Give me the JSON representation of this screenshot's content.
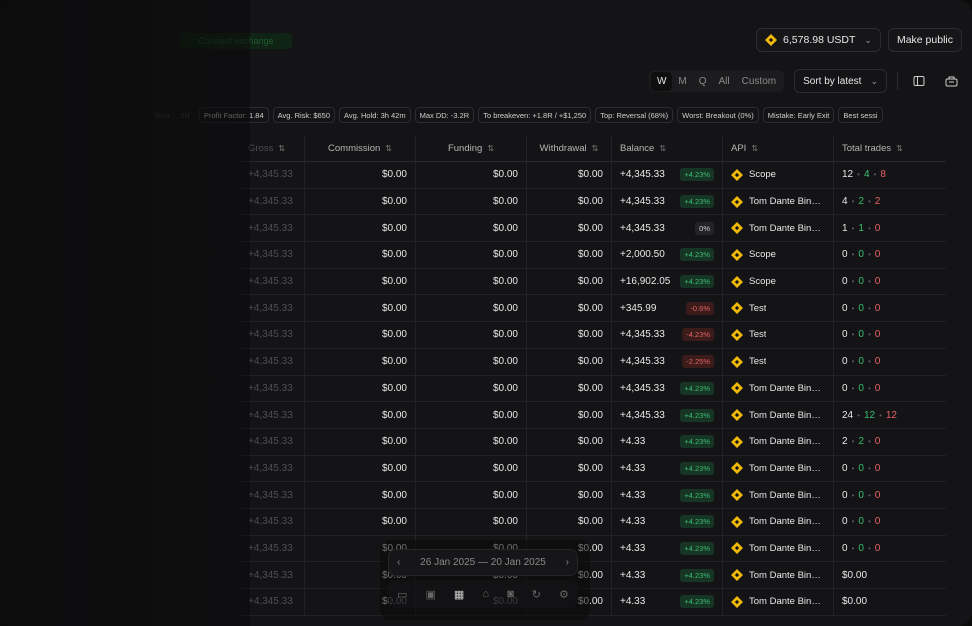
{
  "balance_button": {
    "label": "6,578.98 USDT"
  },
  "make_public": "Make public",
  "ghost_label": "Connect exchange",
  "periods": [
    "W",
    "M",
    "Q",
    "All",
    "Custom"
  ],
  "active_period": "W",
  "sort": "Sort by latest",
  "chips": [
    {
      "label": "Best ... 2R",
      "dim": true
    },
    {
      "label": "Profit Factor: 1.84",
      "dim": false
    },
    {
      "label": "Avg. Risk: $650",
      "dim": false
    },
    {
      "label": "Avg. Hold: 3h 42m",
      "dim": false
    },
    {
      "label": "Max DD: -3.2R",
      "dim": false
    },
    {
      "label": "To breakeven: +1.8R / +$1,250",
      "dim": false
    },
    {
      "label": "Top: Reversal (68%)",
      "dim": false
    },
    {
      "label": "Worst: Breakout (0%)",
      "dim": false
    },
    {
      "label": "Mistake: Early Exit",
      "dim": false
    },
    {
      "label": "Best sessi",
      "dim": false
    }
  ],
  "columns": {
    "gross": "Gross",
    "commission": "Commission",
    "funding": "Funding",
    "withdrawal": "Withdrawal",
    "balance": "Balance",
    "api": "API",
    "total": "Total trades"
  },
  "rows": [
    {
      "gross": "+4,345.33",
      "commission": "$0.00",
      "funding": "$0.00",
      "withdrawal": "$0.00",
      "balance": "+4,345.33",
      "badge": "+4.23%",
      "badge_type": "pos",
      "api": "Scope",
      "total": [
        "12",
        "4",
        "8"
      ]
    },
    {
      "gross": "+4,345.33",
      "commission": "$0.00",
      "funding": "$0.00",
      "withdrawal": "$0.00",
      "balance": "+4,345.33",
      "badge": "+4.23%",
      "badge_type": "pos",
      "api": "Tom Dante Binan...",
      "total": [
        "4",
        "2",
        "2"
      ]
    },
    {
      "gross": "+4,345.33",
      "commission": "$0.00",
      "funding": "$0.00",
      "withdrawal": "$0.00",
      "balance": "+4,345.33",
      "badge": "0%",
      "badge_type": "zero",
      "api": "Tom Dante Binan...",
      "total": [
        "1",
        "1",
        "0"
      ]
    },
    {
      "gross": "+4,345.33",
      "commission": "$0.00",
      "funding": "$0.00",
      "withdrawal": "$0.00",
      "balance": "+2,000.50",
      "badge": "+4.23%",
      "badge_type": "pos",
      "api": "Scope",
      "total": [
        "0",
        "0",
        "0"
      ]
    },
    {
      "gross": "+4,345.33",
      "commission": "$0.00",
      "funding": "$0.00",
      "withdrawal": "$0.00",
      "balance": "+16,902.05",
      "badge": "+4.23%",
      "badge_type": "pos",
      "api": "Scope",
      "total": [
        "0",
        "0",
        "0"
      ]
    },
    {
      "gross": "+4,345.33",
      "commission": "$0.00",
      "funding": "$0.00",
      "withdrawal": "$0.00",
      "balance": "+345.99",
      "badge": "-0.6%",
      "badge_type": "neg",
      "api": "Test",
      "total": [
        "0",
        "0",
        "0"
      ]
    },
    {
      "gross": "+4,345.33",
      "commission": "$0.00",
      "funding": "$0.00",
      "withdrawal": "$0.00",
      "balance": "+4,345.33",
      "badge": "-4.23%",
      "badge_type": "neg",
      "api": "Test",
      "total": [
        "0",
        "0",
        "0"
      ]
    },
    {
      "gross": "+4,345.33",
      "commission": "$0.00",
      "funding": "$0.00",
      "withdrawal": "$0.00",
      "balance": "+4,345.33",
      "badge": "-2.25%",
      "badge_type": "neg",
      "api": "Test",
      "total": [
        "0",
        "0",
        "0"
      ]
    },
    {
      "gross": "+4,345.33",
      "commission": "$0.00",
      "funding": "$0.00",
      "withdrawal": "$0.00",
      "balance": "+4,345.33",
      "badge": "+4.23%",
      "badge_type": "pos",
      "api": "Tom Dante Binan...",
      "total": [
        "0",
        "0",
        "0"
      ]
    },
    {
      "gross": "+4,345.33",
      "commission": "$0.00",
      "funding": "$0.00",
      "withdrawal": "$0.00",
      "balance": "+4,345.33",
      "badge": "+4.23%",
      "badge_type": "pos",
      "api": "Tom Dante Binan...",
      "total": [
        "24",
        "12",
        "12"
      ]
    },
    {
      "gross": "+4,345.33",
      "commission": "$0.00",
      "funding": "$0.00",
      "withdrawal": "$0.00",
      "balance": "+4.33",
      "badge": "+4.23%",
      "badge_type": "pos",
      "api": "Tom Dante Binan...",
      "total": [
        "2",
        "2",
        "0"
      ]
    },
    {
      "gross": "+4,345.33",
      "commission": "$0.00",
      "funding": "$0.00",
      "withdrawal": "$0.00",
      "balance": "+4.33",
      "badge": "+4.23%",
      "badge_type": "pos",
      "api": "Tom Dante Binan...",
      "total": [
        "0",
        "0",
        "0"
      ]
    },
    {
      "gross": "+4,345.33",
      "commission": "$0.00",
      "funding": "$0.00",
      "withdrawal": "$0.00",
      "balance": "+4.33",
      "badge": "+4.23%",
      "badge_type": "pos",
      "api": "Tom Dante Binan...",
      "total": [
        "0",
        "0",
        "0"
      ]
    },
    {
      "gross": "+4,345.33",
      "commission": "$0.00",
      "funding": "$0.00",
      "withdrawal": "$0.00",
      "balance": "+4.33",
      "badge": "+4.23%",
      "badge_type": "pos",
      "api": "Tom Dante Binan...",
      "total": [
        "0",
        "0",
        "0"
      ]
    },
    {
      "gross": "+4,345.33",
      "commission": "$0.00",
      "funding": "$0.00",
      "withdrawal": "$0.00",
      "balance": "+4.33",
      "badge": "+4.23%",
      "badge_type": "pos",
      "api": "Tom Dante Binan...",
      "total": [
        "0",
        "0",
        "0"
      ]
    },
    {
      "gross": "+4,345.33",
      "commission": "$0.00",
      "funding": "$0.00",
      "withdrawal": "$0.00",
      "balance": "+4.33",
      "badge": "+4.23%",
      "badge_type": "pos",
      "api": "Tom Dante Binan...",
      "total_text": "$0.00"
    },
    {
      "gross": "+4,345.33",
      "commission": "$0.00",
      "funding": "$0.00",
      "withdrawal": "$0.00",
      "balance": "+4.33",
      "badge": "+4.23%",
      "badge_type": "pos",
      "api": "Tom Dante Binan...",
      "total_text": "$0.00"
    }
  ],
  "date_range": "26 Jan 2025 — 20 Jan 2025",
  "colors": {
    "positive": "#3bbf73",
    "negative": "#e46262",
    "accent_coin": "#f0b90b"
  }
}
